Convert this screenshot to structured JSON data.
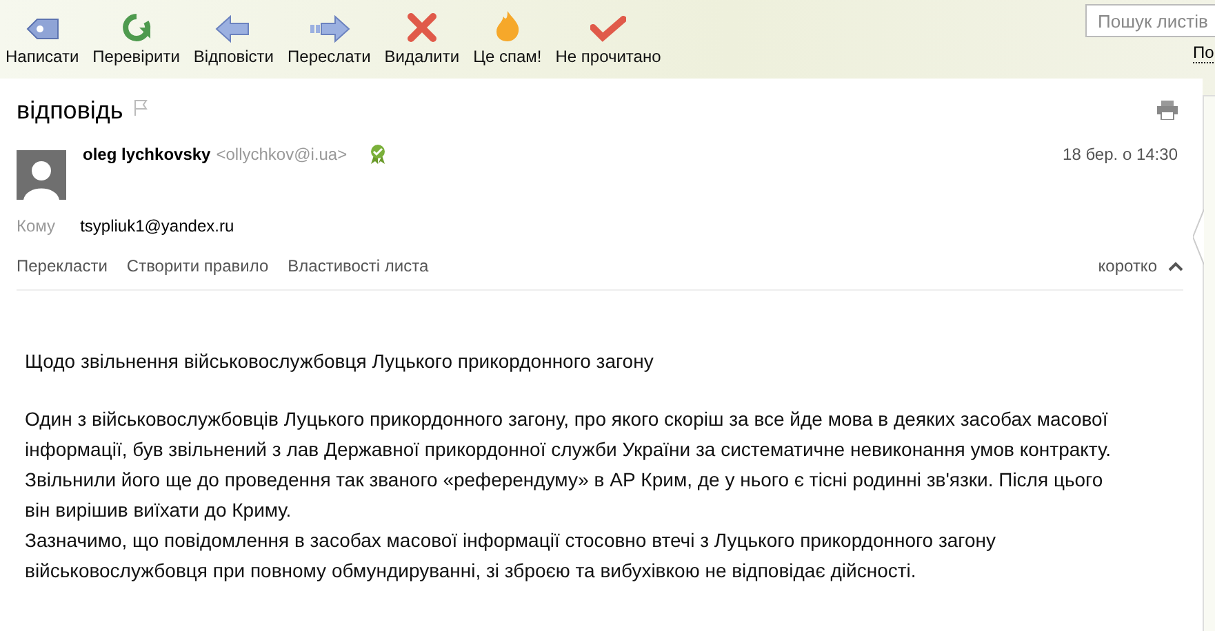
{
  "toolbar": [
    {
      "label": "Написати",
      "kind": "compose"
    },
    {
      "label": "Перевірити",
      "kind": "refresh"
    },
    {
      "label": "Відповісти",
      "kind": "reply"
    },
    {
      "label": "Переслати",
      "kind": "forward"
    },
    {
      "label": "Видалити",
      "kind": "delete"
    },
    {
      "label": "Це спам!",
      "kind": "spam"
    },
    {
      "label": "Не прочитано",
      "kind": "unread"
    }
  ],
  "search": {
    "placeholder": "Пошук листів",
    "link": "По"
  },
  "message": {
    "subject": "відповідь",
    "sender_name": "oleg lychkovsky",
    "sender_email": "<ollychkov@i.ua>",
    "date": "18 бер. о 14:30",
    "to_label": "Кому",
    "to": "tsypliuk1@yandex.ru",
    "actions": [
      "Перекласти",
      "Створити правило",
      "Властивості листа"
    ],
    "collapse": "коротко",
    "body": [
      "Щодо звільнення військовослужбовця Луцького прикордонного загону",
      "Один з військовослужбовців Луцького прикордонного загону, про якого скоріш за все йде мова в деяких засобах масової інформації, був звільнений з лав Державної прикордонної служби України за систематичне невиконання умов контракту. Звільнили його ще до проведення так званого «референдуму» в АР Крим, де у нього є тісні родинні зв'язки. Після цього він вирішив виїхати до Криму.\nЗазначимо, що повідомлення в засобах масової інформації стосовно втечі з Луцького прикордонного загону військовослужбовця при повному обмундируванні, зі зброєю та вибухівкою не відповідає дійсності."
    ]
  }
}
